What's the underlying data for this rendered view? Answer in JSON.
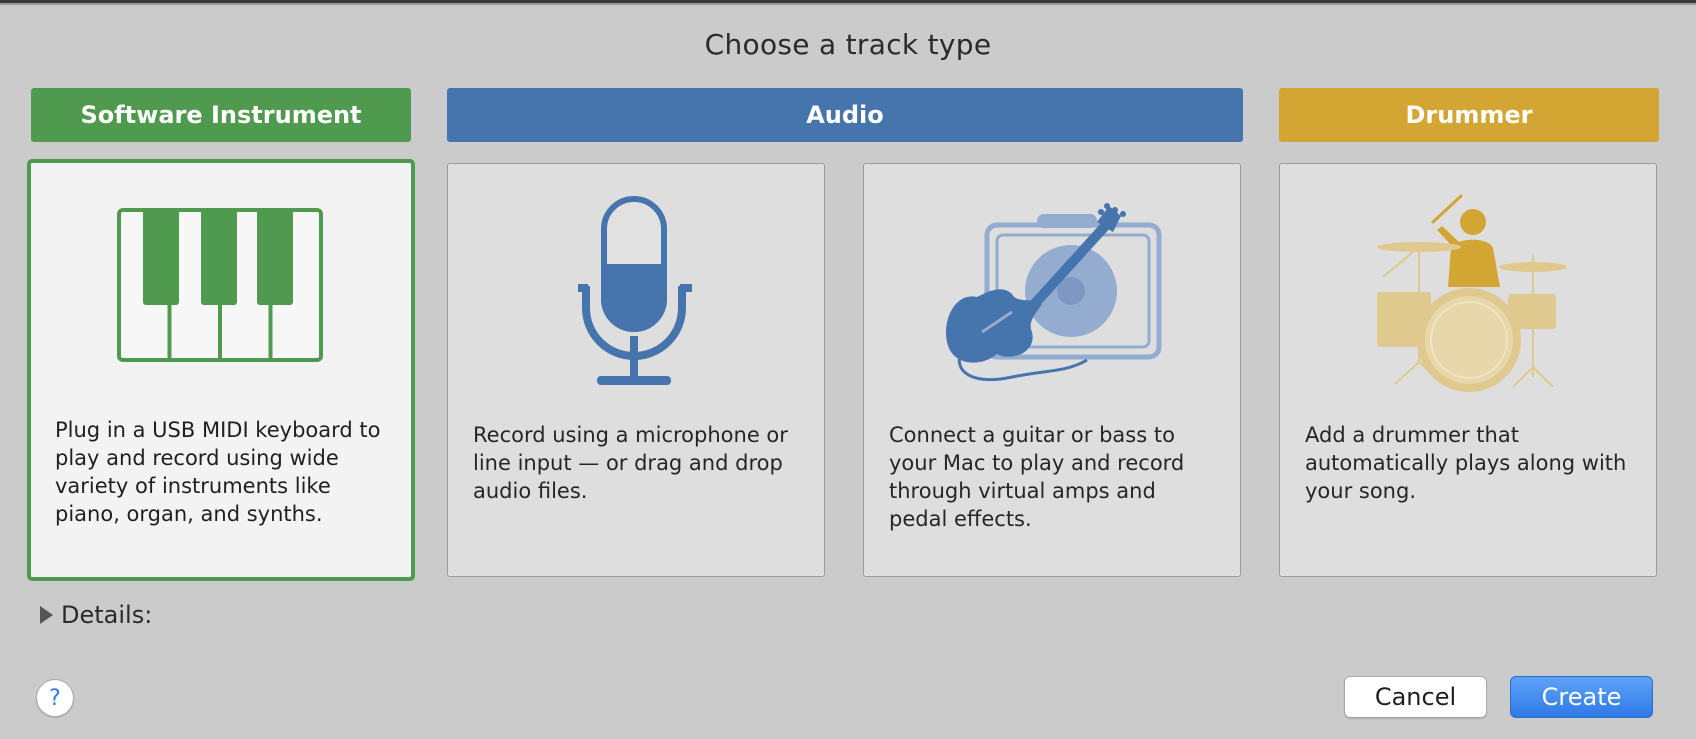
{
  "dialog": {
    "title": "Choose a track type"
  },
  "categories": {
    "software_instrument": "Software Instrument",
    "audio": "Audio",
    "drummer": "Drummer"
  },
  "cards": [
    {
      "id": "software-instrument",
      "icon": "piano-keyboard-icon",
      "description": "Plug in a USB MIDI keyboard to play and record using wide variety of instruments like piano, organ, and synths.",
      "selected": true
    },
    {
      "id": "microphone",
      "icon": "microphone-icon",
      "description": "Record using a microphone or line input — or drag and drop audio files.",
      "selected": false
    },
    {
      "id": "guitar-bass",
      "icon": "guitar-amp-icon",
      "description": "Connect a guitar or bass to your Mac to play and record through virtual amps and pedal effects.",
      "selected": false
    },
    {
      "id": "drummer",
      "icon": "drummer-icon",
      "description": "Add a drummer that automatically plays along with your song.",
      "selected": false
    }
  ],
  "details": {
    "label": "Details:"
  },
  "buttons": {
    "help": "?",
    "cancel": "Cancel",
    "create": "Create"
  },
  "colors": {
    "software_instrument": "#4f9a4f",
    "audio": "#4675ae",
    "drummer": "#d3a634",
    "primary_button": "#2f7ae5"
  }
}
